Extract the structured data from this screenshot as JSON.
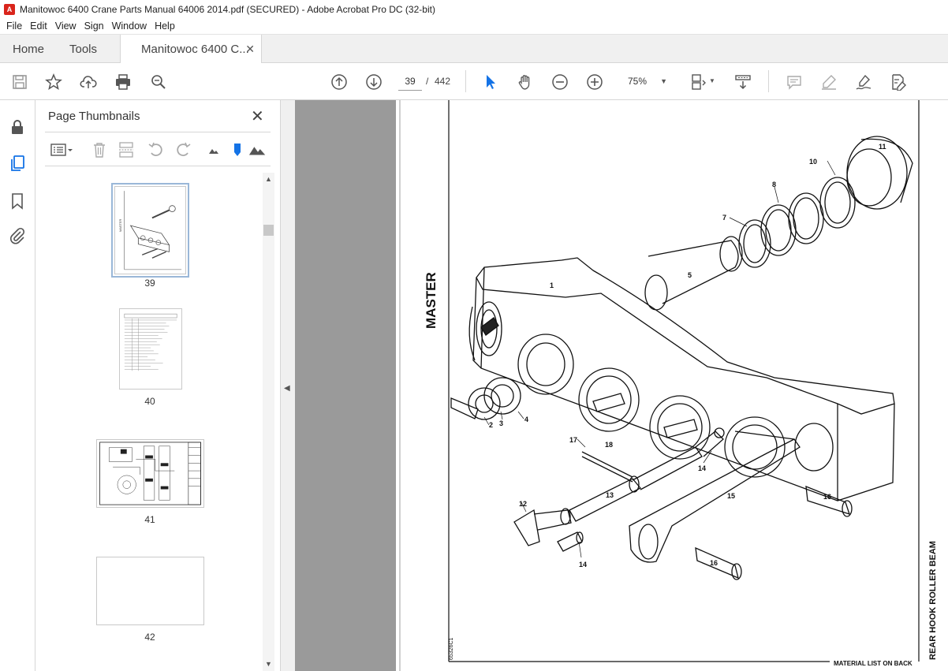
{
  "window": {
    "title": "Manitowoc 6400 Crane Parts Manual 64006 2014.pdf (SECURED) - Adobe Acrobat Pro DC (32-bit)"
  },
  "menu": [
    "File",
    "Edit",
    "View",
    "Sign",
    "Window",
    "Help"
  ],
  "tabs": {
    "home": "Home",
    "tools": "Tools",
    "document": "Manitowoc 6400 C..."
  },
  "toolbar": {
    "page_current": "39",
    "page_separator": "/",
    "page_total": "442",
    "zoom": "75%"
  },
  "panel": {
    "title": "Page Thumbnails",
    "thumbnails": [
      {
        "label": "39",
        "selected": true
      },
      {
        "label": "40",
        "selected": false
      },
      {
        "label": "41",
        "selected": false
      },
      {
        "label": "42",
        "selected": false
      }
    ]
  },
  "drawing": {
    "master_label": "MASTER",
    "side_title": "REAR HOOK ROLLER BEAM",
    "footer": "MATERIAL LIST ON BACK",
    "drawing_number": "65326C1",
    "callouts": [
      "1",
      "2",
      "3",
      "4",
      "5",
      "7",
      "8",
      "10",
      "11",
      "12",
      "13",
      "14",
      "14",
      "15",
      "16",
      "16",
      "17",
      "18"
    ]
  },
  "colors": {
    "accent_blue": "#1473e6",
    "app_red": "#d9241b",
    "doc_background": "#9a9a9a"
  }
}
